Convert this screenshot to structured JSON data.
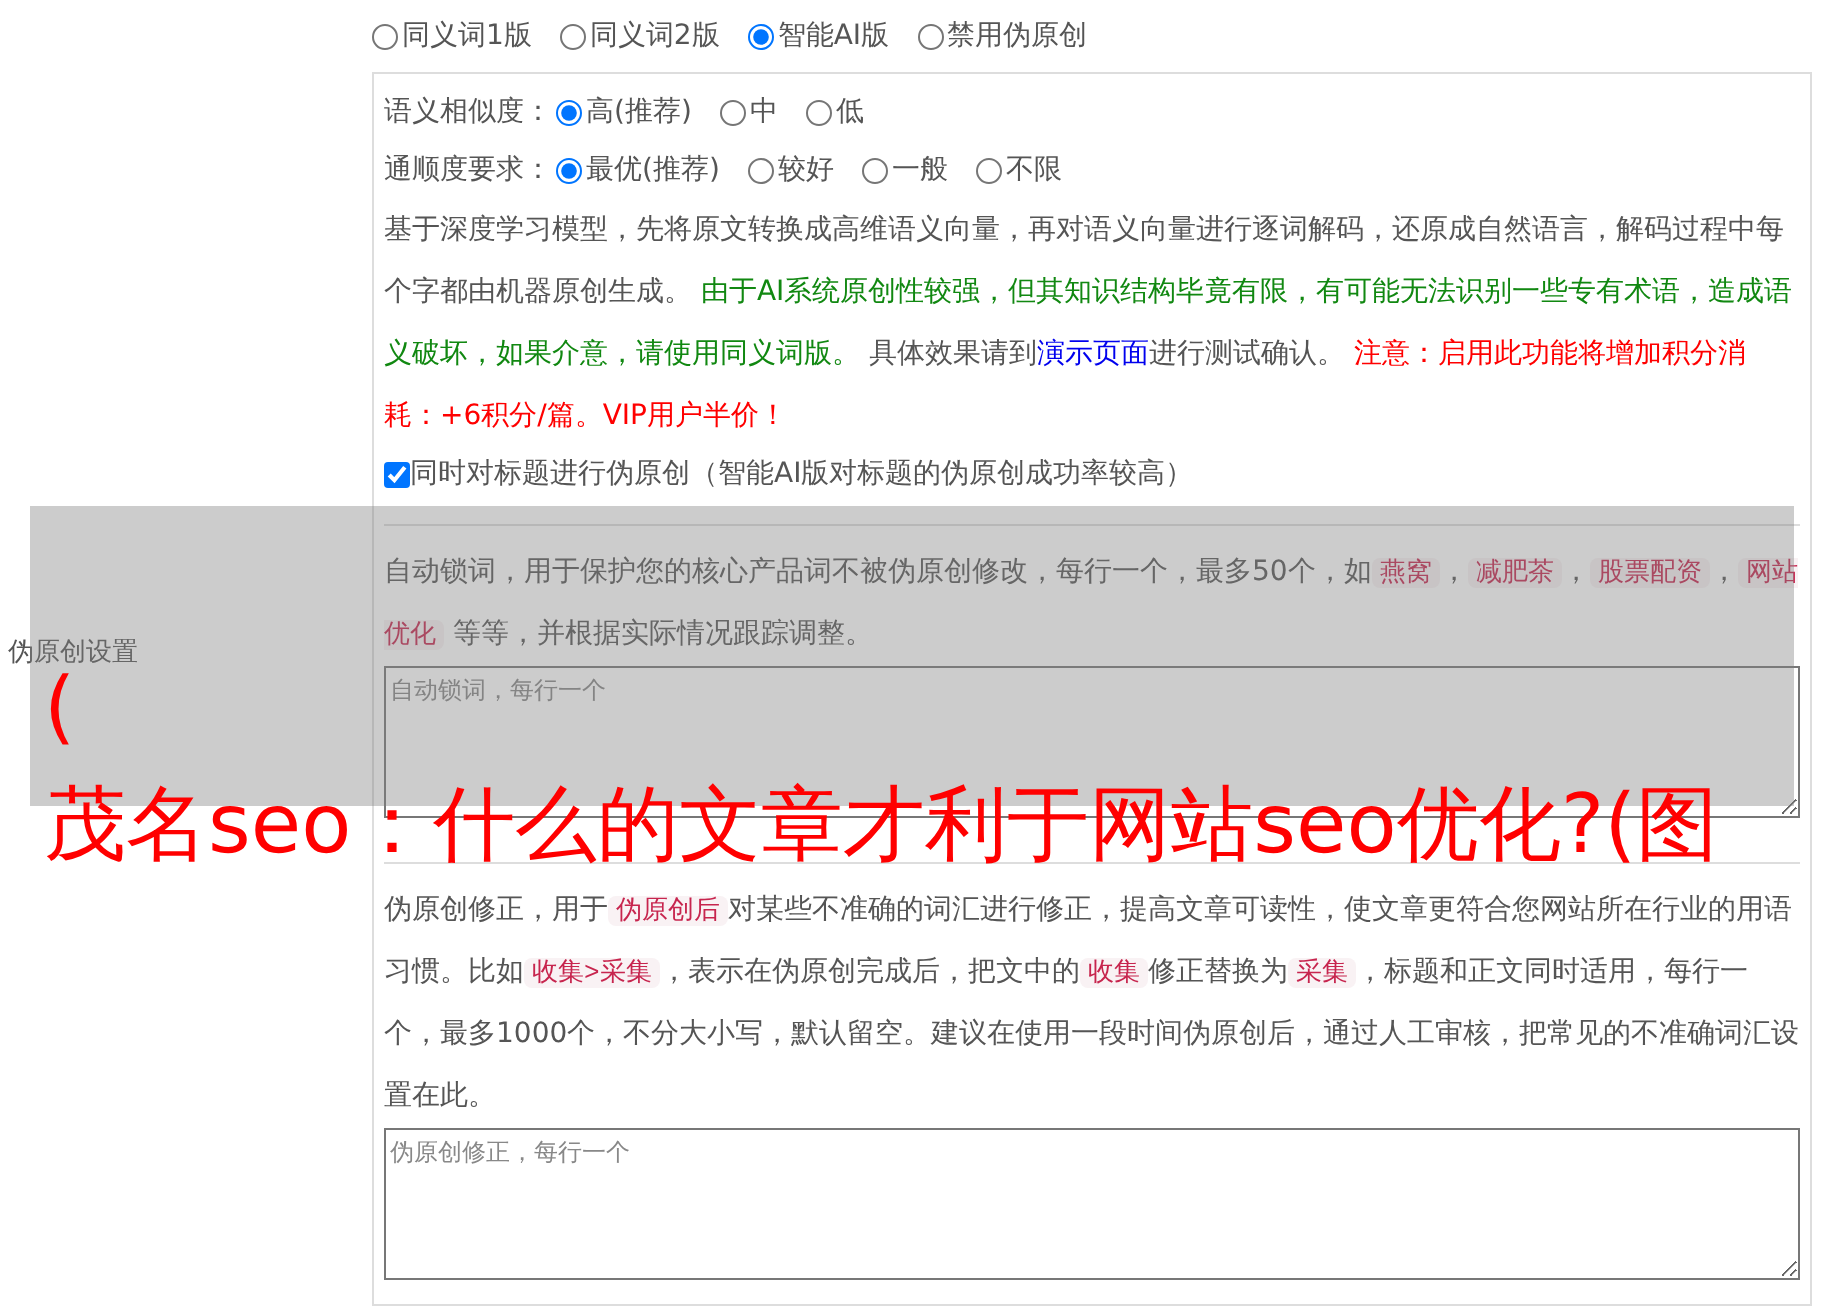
{
  "mode_options": [
    {
      "label": "同义词1版",
      "selected": false
    },
    {
      "label": "同义词2版",
      "selected": false
    },
    {
      "label": "智能AI版",
      "selected": true
    },
    {
      "label": "禁用伪原创",
      "selected": false
    }
  ],
  "similarity": {
    "label": "语义相似度：",
    "options": [
      {
        "label": "高(推荐)",
        "selected": true
      },
      {
        "label": "中",
        "selected": false
      },
      {
        "label": "低",
        "selected": false
      }
    ]
  },
  "fluency": {
    "label": "通顺度要求：",
    "options": [
      {
        "label": "最优(推荐)",
        "selected": true
      },
      {
        "label": "较好",
        "selected": false
      },
      {
        "label": "一般",
        "selected": false
      },
      {
        "label": "不限",
        "selected": false
      }
    ]
  },
  "description": [
    {
      "kind": "plain",
      "text": "基于深度学习模型，先将原文转换成高维语义向量，再对语义向量进行逐词解码，还原成自然语言，解码过程中每个字都由机器原创生成。 "
    },
    {
      "kind": "green",
      "text": "由于AI系统原创性较强，但其知识结构毕竟有限，有可能无法识别一些专有术语，造成语义破坏，如果介意，请使用同义词版。"
    },
    {
      "kind": "plain",
      "text": " 具体效果请到"
    },
    {
      "kind": "link",
      "text": "演示页面"
    },
    {
      "kind": "plain",
      "text": "进行测试确认。 "
    },
    {
      "kind": "red",
      "text": "注意：启用此功能将增加积分消耗：+6积分/篇。VIP用户半价！"
    }
  ],
  "title_checkbox": {
    "label": "同时对标题进行伪原创（智能AI版对标题的伪原创成功率较高）",
    "checked": true
  },
  "side_label": "伪原创设置",
  "lock_words": {
    "description": [
      {
        "kind": "plain",
        "text": "自动锁词，用于保护您的核心产品词不被伪原创修改，每行一个，最多50个，如"
      },
      {
        "kind": "tag",
        "text": "燕窝"
      },
      {
        "kind": "plain",
        "text": "，"
      },
      {
        "kind": "tag",
        "text": "减肥茶"
      },
      {
        "kind": "plain",
        "text": "，"
      },
      {
        "kind": "tag",
        "text": "股票配资"
      },
      {
        "kind": "plain",
        "text": "，"
      },
      {
        "kind": "tag",
        "text": "网站优化"
      },
      {
        "kind": "plain",
        "text": " 等等，并根据实际情况跟踪调整。"
      }
    ],
    "placeholder": "自动锁词，每行一个"
  },
  "correction": {
    "description": [
      {
        "kind": "plain",
        "text": "伪原创修正，用于"
      },
      {
        "kind": "tag",
        "text": "伪原创后"
      },
      {
        "kind": "plain",
        "text": "对某些不准确的词汇进行修正，提高文章可读性，使文章更符合您网站所在行业的用语习惯。比如"
      },
      {
        "kind": "tag",
        "text": "收集>采集"
      },
      {
        "kind": "plain",
        "text": "，表示在伪原创完成后，把文中的"
      },
      {
        "kind": "tag",
        "text": "收集"
      },
      {
        "kind": "plain",
        "text": "修正替换为"
      },
      {
        "kind": "tag",
        "text": "采集"
      },
      {
        "kind": "plain",
        "text": "，标题和正文同时适用，每行一个，最多1000个，不分大小写，默认留空。建议在使用一段时间伪原创后，通过人工审核，把常见的不准确词汇设置在此。"
      }
    ],
    "placeholder": "伪原创修正，每行一个"
  },
  "overlay": {
    "lines": [
      "(",
      "茂名seo：什么的文章才利于网站seo优化?(图"
    ]
  }
}
